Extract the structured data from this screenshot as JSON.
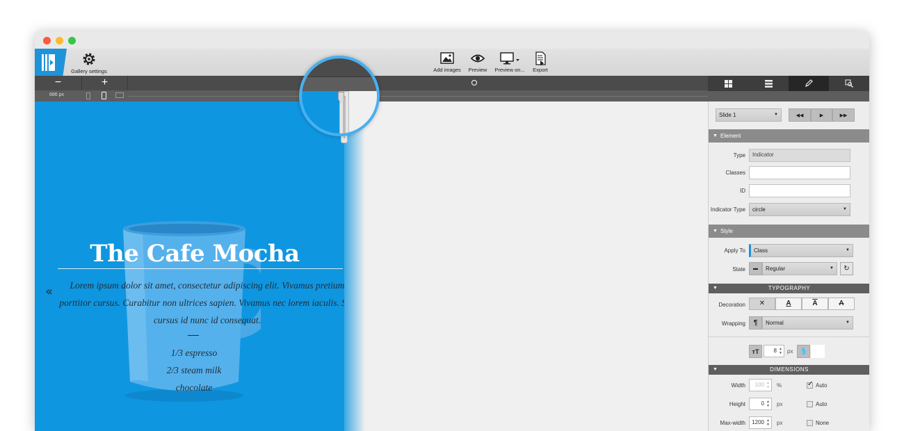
{
  "toolbar": {
    "gallery_settings": "Gallery settings",
    "add_images": "Add images",
    "preview": "Preview",
    "preview_on": "Preview on...",
    "export": "Export"
  },
  "zoom": {
    "minus": "−",
    "plus": "+",
    "width_label": "686 px"
  },
  "slide": {
    "title": "The Cafe Mocha",
    "body": "Lorem ipsum dolor sit amet, consectetur adipiscing elit. Vivamus pretium porttitor cursus. Curabitur non ultrices sapien. Vivamus nec lorem iaculis. Sed cursus id nunc id consequat.",
    "dash": "—",
    "recipe": [
      "1/3 espresso",
      "2/3 steam milk",
      "chocolate"
    ],
    "prev_arrow": "«",
    "bg_color": "#0f96e0"
  },
  "panel": {
    "slide_select": "Slide 1",
    "element_header": "Element",
    "type_label": "Type",
    "type_value": "Indicator",
    "classes_label": "Classes",
    "id_label": "ID",
    "indicator_type_label": "Indicator Type",
    "indicator_type_value": "circle",
    "style_header": "Style",
    "apply_to_label": "Apply To",
    "apply_to_value": "Class",
    "state_label": "State",
    "state_value": "Regular",
    "typography_header": "TYPOGRAPHY",
    "decoration_label": "Decoration",
    "wrapping_label": "Wrapping",
    "wrapping_value": "Normal",
    "font_size_value": "8",
    "font_size_unit": "px",
    "dimensions_header": "DIMENSIONS",
    "width_label": "Width",
    "width_value": "100",
    "width_unit": "%",
    "width_auto": "Auto",
    "height_label": "Height",
    "height_value": "0",
    "height_unit": "px",
    "height_auto": "Auto",
    "maxwidth_label": "Max-width",
    "maxwidth_value": "1200",
    "maxwidth_unit": "px",
    "maxwidth_none": "None"
  },
  "colors": {
    "accent_blue": "#1f93d8",
    "magnifier_ring": "#46b0f2",
    "section_header": "#8b8b8b"
  }
}
